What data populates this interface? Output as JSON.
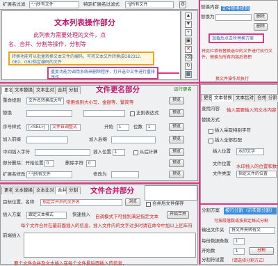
{
  "top": {
    "filter_label": "扩展名过滤",
    "filter_value": "*.*|所有文件",
    "type_label": "特定扩展名过滤式",
    "type_value": "*||所有文件",
    "list_title": "文本列表操作部分",
    "list_desc_1": "此列表为需要处理的文件，点",
    "list_desc_2": "名、合并、分割等操作，分割等",
    "yellow_note": "转换功能可以批量转换文本文件的编码，可将文本文件转换成GB2312、GB2、GB2指定编码的文件",
    "pink_note": "重复功能为调用系统来删除程序，打开选中文件进行重排序作"
  },
  "right_top": {
    "replace_label": "替换内容",
    "replace_hint": "支持替换规则",
    "replace_to_label": "替换为",
    "action_label": "删除",
    "note": "加载后点击所替换方案"
  },
  "right_mid": {
    "warning": "将此栏填有替换选中的文件进行执行文件，替换为所有内容后将把",
    "warning2": "换文件操作后执行"
  },
  "rename": {
    "tabs": [
      "更名",
      "文本替换",
      "文本比对",
      "合并",
      "分割"
    ],
    "section_title": "文件更名部分",
    "run_label": "运行更名",
    "rule_label": "重命规则",
    "rule_value": "文件名转换成大写",
    "rule_hint": "常用规则大小写、金额等、繁简等",
    "preview": "预览",
    "replace_label": "替换",
    "regex_label": "正则表达式",
    "seq_label": "序号样式",
    "seq_value": "[.<SEL>]",
    "seq_custom": "文件自调整式",
    "start_label": "开始",
    "start_value": "1",
    "digits_label": "位数",
    "digits_value": "1",
    "prefix_label": "加入前缀",
    "suffix_label": "加入后缀",
    "mid_label": "中间插入字符",
    "insert_pos_label": "插入位置",
    "insert_pos": "1",
    "from_end_label": "从后计算",
    "cut_label": "部分删除：开始位置",
    "cut_start": "0",
    "cut_len_label": "删除字符",
    "cut_len": "0",
    "ext_label": "扩展名修改",
    "ext_value": "*.*|所有文件",
    "change_label": "修改为",
    "rename_btn": "更名"
  },
  "merge": {
    "tabs": [
      "更名",
      "文本替换",
      "文本比对",
      "合并",
      "分割"
    ],
    "section_title": "文件合并部分",
    "dir_label": "目标位置，名称",
    "dir_hint": "指定合并后的文件名",
    "browse": "浏览",
    "after_merge": "合并后文件保存",
    "insert_label": "插入方案",
    "insert_value": "跟定文本模式",
    "quick_insert": "快速插入",
    "insert_hint": "自调模式下可插别满足指定文本",
    "start_merge": "开始合并",
    "desc": "每个文件合并在最前面插入的信息，插入文件内的文字过多时请在命令中加以上回车符",
    "pre_insert_label": "前端插入",
    "foot": "要个文件合并及文本插入在每个文件最后面插入的信息，"
  },
  "right_bottom": {
    "tabs": [
      "更名",
      "文本替换",
      "文本比对",
      "合并",
      "分割"
    ],
    "section_title": "文本替换部分",
    "find_label": "查找内容",
    "find_hint": "输入需要输入的文本内容",
    "mode_label": "替换方式",
    "opt1": "插入采取特别字符",
    "opt2": "插入全部匹配",
    "char_label": "字符",
    "char_value": "全部替换",
    "insert_pos_label": "插入位置",
    "insert_pos_value": "水印文字",
    "replace_to": "替换为",
    "file_label": "文件位置",
    "file_value": "指定文件的位置",
    "red_note": "水印插入的位置和数量",
    "file_type_label": "文件类型",
    "split_label": "分割方案",
    "split_value": "按行分割（示实际分割）",
    "split_hint": "可按段落数或按指定格式分割",
    "output_label": "输出文件夹",
    "output_value": "将文件夹转有文",
    "count_label": "每份数据条数",
    "count_value": "1",
    "start_label": "开始数",
    "start_value": "1",
    "split_btn": "开始分割",
    "sep_label": "分割符设置",
    "sep_value": "（请选择分割方式）",
    "red_btn": "分割"
  },
  "colors": {
    "pink": "#e0368a",
    "blue": "#2f7fd3",
    "red": "#d11f1f"
  }
}
